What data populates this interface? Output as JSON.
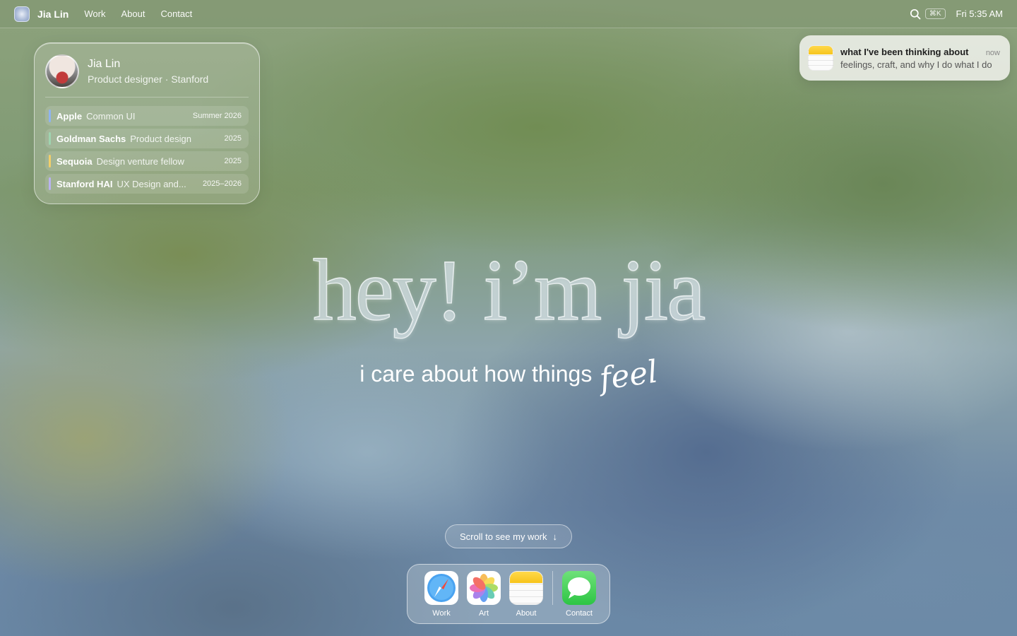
{
  "menubar": {
    "brand": "Jia Lin",
    "links": [
      "Work",
      "About",
      "Contact"
    ],
    "shortcut": "⌘K",
    "clock": "Fri 5:35 AM"
  },
  "profile": {
    "name": "Jia Lin",
    "subtitle": "Product designer · Stanford",
    "experience": [
      {
        "company": "Apple",
        "role": "Common UI",
        "date": "Summer 2026",
        "color": "#8fb4f0"
      },
      {
        "company": "Goldman Sachs",
        "role": "Product design",
        "date": "2025",
        "color": "#9fd4b0"
      },
      {
        "company": "Sequoia",
        "role": "Design venture fellow",
        "date": "2025",
        "color": "#f2cf6a"
      },
      {
        "company": "Stanford HAI",
        "role": "UX Design and...",
        "date": "2025–2026",
        "color": "#b9b3f0"
      }
    ]
  },
  "notification": {
    "title": "what I've been thinking about",
    "time": "now",
    "body": "feelings, craft, and why I do what I do"
  },
  "hero": {
    "title": "hey! i’m jia",
    "subtitle": "i care about how things",
    "accent": "feel"
  },
  "scroll_cta": "Scroll to see my work",
  "dock": {
    "items": [
      {
        "label": "Work",
        "icon": "safari-icon"
      },
      {
        "label": "Art",
        "icon": "photos-icon"
      },
      {
        "label": "About",
        "icon": "notes-icon"
      },
      {
        "label": "Contact",
        "icon": "messages-icon"
      }
    ]
  }
}
